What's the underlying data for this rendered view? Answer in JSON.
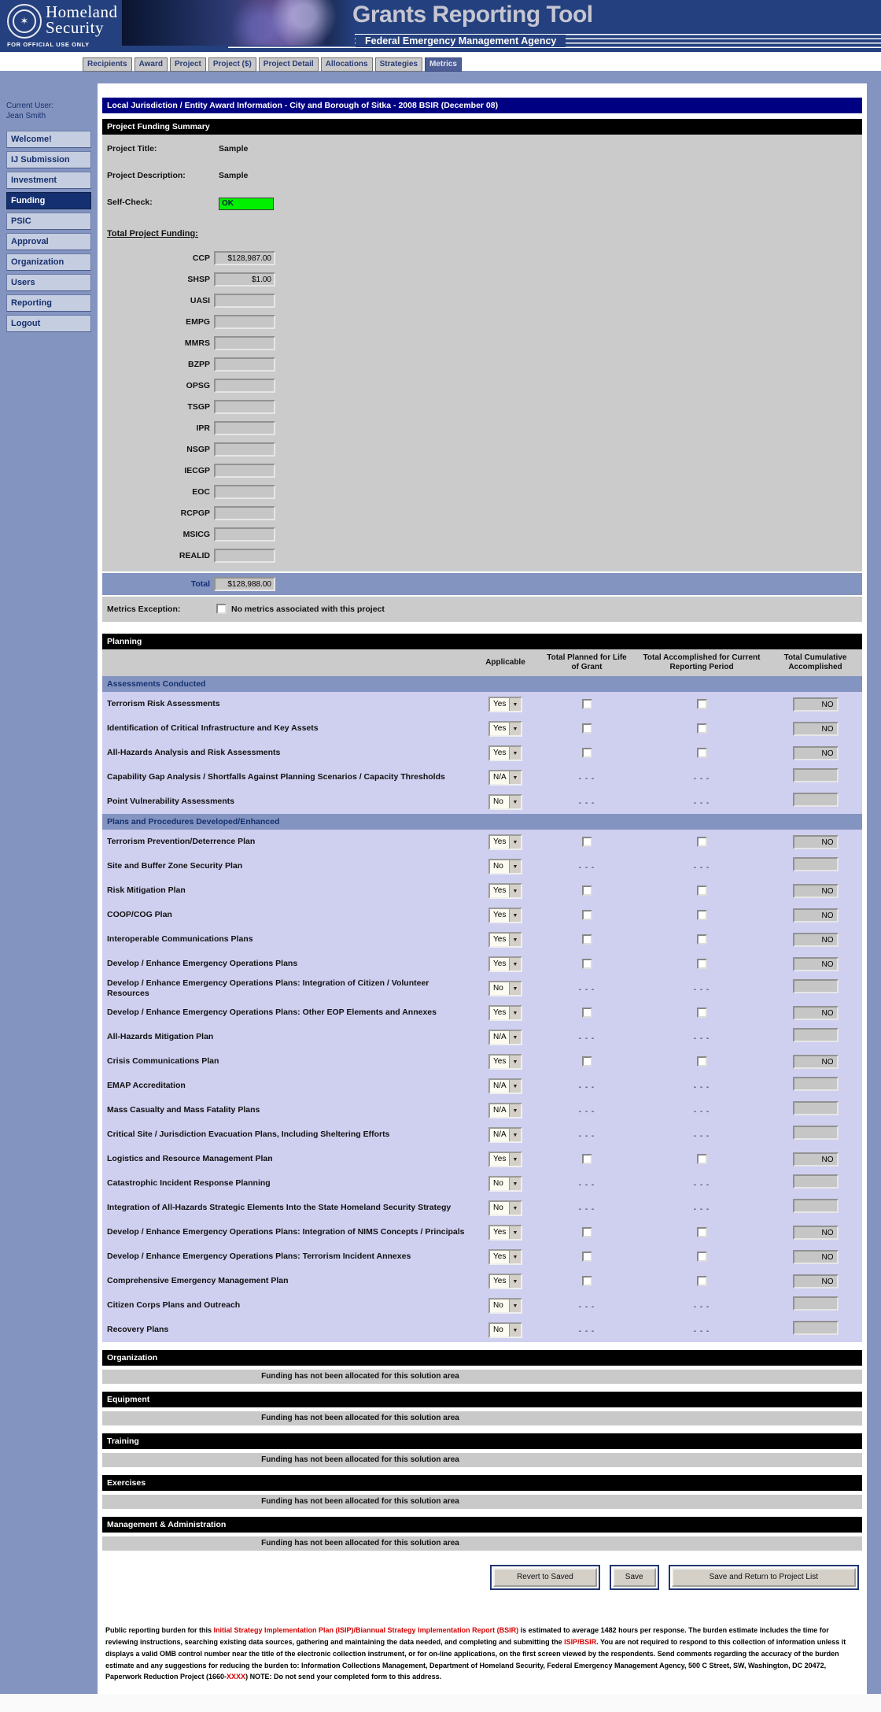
{
  "header": {
    "brand_line1": "Homeland",
    "brand_line2": "Security",
    "fouo": "FOR OFFICIAL USE ONLY",
    "app_title": "Grants Reporting Tool",
    "agency": "Federal Emergency Management Agency",
    "header_color": "#24407e"
  },
  "tabs": [
    {
      "label": "Recipients",
      "active": false
    },
    {
      "label": "Award",
      "active": false
    },
    {
      "label": "Project",
      "active": false
    },
    {
      "label": "Project ($)",
      "active": false
    },
    {
      "label": "Project Detail",
      "active": false
    },
    {
      "label": "Allocations",
      "active": false
    },
    {
      "label": "Strategies",
      "active": false
    },
    {
      "label": "Metrics",
      "active": true
    }
  ],
  "sidebar": {
    "current_user_label": "Current User:",
    "current_user_name": "Jean Smith",
    "items": [
      {
        "label": "Welcome!",
        "active": false
      },
      {
        "label": "IJ Submission",
        "active": false
      },
      {
        "label": "Investment",
        "active": false
      },
      {
        "label": "Funding",
        "active": true
      },
      {
        "label": "PSIC",
        "active": false
      },
      {
        "label": "Approval",
        "active": false
      },
      {
        "label": "Organization",
        "active": false
      },
      {
        "label": "Users",
        "active": false
      },
      {
        "label": "Reporting",
        "active": false
      },
      {
        "label": "Logout",
        "active": false
      }
    ]
  },
  "page": {
    "title_bar": "Local Jurisdiction / Entity Award Information - City and Borough of Sitka - 2008 BSIR (December 08)",
    "funding_summary": {
      "section_label": "Project Funding Summary",
      "project_title_label": "Project Title:",
      "project_title_value": "Sample",
      "project_description_label": "Project Description:",
      "project_description_value": "Sample",
      "self_check_label": "Self-Check:",
      "self_check_value": "OK",
      "self_check_color": "#00f000",
      "total_project_funding_label": "Total Project Funding:",
      "fields": [
        {
          "code": "CCP",
          "value": "$128,987.00"
        },
        {
          "code": "SHSP",
          "value": "$1.00"
        },
        {
          "code": "UASI",
          "value": ""
        },
        {
          "code": "EMPG",
          "value": ""
        },
        {
          "code": "MMRS",
          "value": ""
        },
        {
          "code": "BZPP",
          "value": ""
        },
        {
          "code": "OPSG",
          "value": ""
        },
        {
          "code": "TSGP",
          "value": ""
        },
        {
          "code": "IPR",
          "value": ""
        },
        {
          "code": "NSGP",
          "value": ""
        },
        {
          "code": "IECGP",
          "value": ""
        },
        {
          "code": "EOC",
          "value": ""
        },
        {
          "code": "RCPGP",
          "value": ""
        },
        {
          "code": "MSICG",
          "value": ""
        },
        {
          "code": "REALID",
          "value": ""
        }
      ],
      "total_label": "Total",
      "total_value": "$128,988.00",
      "metrics_exception_label": "Metrics Exception:",
      "metrics_exception_checkbox_label": "No metrics associated with this project",
      "metrics_exception_checked": false
    },
    "planning": {
      "section_label": "Planning",
      "columns": [
        "Applicable",
        "Total Planned for Life of Grant",
        "Total Accomplished for Current Reporting Period",
        "Total Cumulative Accomplished"
      ],
      "na_placeholder": "- - -",
      "groups": [
        {
          "label": "Assessments Conducted",
          "rows": [
            {
              "label": "Terrorism Risk Assessments",
              "applicable": "Yes",
              "cumulative": "NO"
            },
            {
              "label": "Identification of Critical Infrastructure and Key Assets",
              "applicable": "Yes",
              "cumulative": "NO"
            },
            {
              "label": "All-Hazards Analysis and Risk Assessments",
              "applicable": "Yes",
              "cumulative": "NO"
            },
            {
              "label": "Capability Gap Analysis / Shortfalls Against Planning Scenarios / Capacity Thresholds",
              "applicable": "N/A",
              "cumulative": ""
            },
            {
              "label": "Point Vulnerability Assessments",
              "applicable": "No",
              "cumulative": ""
            }
          ]
        },
        {
          "label": "Plans and Procedures Developed/Enhanced",
          "rows": [
            {
              "label": "Terrorism Prevention/Deterrence Plan",
              "applicable": "Yes",
              "cumulative": "NO"
            },
            {
              "label": "Site and Buffer Zone Security Plan",
              "applicable": "No",
              "cumulative": ""
            },
            {
              "label": "Risk Mitigation Plan",
              "applicable": "Yes",
              "cumulative": "NO"
            },
            {
              "label": "COOP/COG Plan",
              "applicable": "Yes",
              "cumulative": "NO"
            },
            {
              "label": "Interoperable Communications Plans",
              "applicable": "Yes",
              "cumulative": "NO"
            },
            {
              "label": "Develop / Enhance Emergency Operations Plans",
              "applicable": "Yes",
              "cumulative": "NO"
            },
            {
              "label": "Develop / Enhance Emergency Operations Plans: Integration of Citizen / Volunteer Resources",
              "applicable": "No",
              "cumulative": ""
            },
            {
              "label": "Develop / Enhance Emergency Operations Plans: Other EOP Elements and Annexes",
              "applicable": "Yes",
              "cumulative": "NO"
            },
            {
              "label": "All-Hazards Mitigation Plan",
              "applicable": "N/A",
              "cumulative": ""
            },
            {
              "label": "Crisis Communications Plan",
              "applicable": "Yes",
              "cumulative": "NO"
            },
            {
              "label": "EMAP Accreditation",
              "applicable": "N/A",
              "cumulative": ""
            },
            {
              "label": "Mass Casualty and Mass Fatality Plans",
              "applicable": "N/A",
              "cumulative": ""
            },
            {
              "label": "Critical Site / Jurisdiction Evacuation Plans, Including Sheltering Efforts",
              "applicable": "N/A",
              "cumulative": ""
            },
            {
              "label": "Logistics and Resource Management Plan",
              "applicable": "Yes",
              "cumulative": "NO"
            },
            {
              "label": "Catastrophic Incident Response Planning",
              "applicable": "No",
              "cumulative": ""
            },
            {
              "label": "Integration of All-Hazards Strategic Elements Into the State Homeland Security Strategy",
              "applicable": "No",
              "cumulative": ""
            },
            {
              "label": "Develop / Enhance Emergency Operations Plans: Integration of NIMS Concepts / Principals",
              "applicable": "Yes",
              "cumulative": "NO"
            },
            {
              "label": "Develop / Enhance Emergency Operations Plans: Terrorism Incident Annexes",
              "applicable": "Yes",
              "cumulative": "NO"
            },
            {
              "label": "Comprehensive Emergency Management Plan",
              "applicable": "Yes",
              "cumulative": "NO"
            },
            {
              "label": "Citizen Corps Plans and Outreach",
              "applicable": "No",
              "cumulative": ""
            },
            {
              "label": "Recovery Plans",
              "applicable": "No",
              "cumulative": ""
            }
          ]
        }
      ]
    },
    "solution_areas": [
      {
        "label": "Organization",
        "message": "Funding has not been allocated for this solution area"
      },
      {
        "label": "Equipment",
        "message": "Funding has not been allocated for this solution area"
      },
      {
        "label": "Training",
        "message": "Funding has not been allocated for this solution area"
      },
      {
        "label": "Exercises",
        "message": "Funding has not been allocated for this solution area"
      },
      {
        "label": "Management & Administration",
        "message": "Funding has not been allocated for this solution area"
      }
    ],
    "buttons": [
      "Revert to Saved",
      "Save",
      "Save and Return to Project List"
    ],
    "footer_segments": [
      {
        "text": "Public reporting burden for this ",
        "style": "normal"
      },
      {
        "text": "Initial Strategy Implementation Plan (ISIP)/Biannual Strategy Implementation Report (BSIR)",
        "style": "red"
      },
      {
        "text": " is estimated to average 1482 hours per response. The burden estimate includes the time for reviewing instructions, searching existing data sources, gathering and maintaining the data needed, and completing and submitting the ",
        "style": "normal"
      },
      {
        "text": "ISIP/BSIR",
        "style": "red"
      },
      {
        "text": ". You are not required to respond to this collection of information unless it displays a valid OMB control number near the title of the electronic collection instrument, or for on-line applications, on the first screen viewed by the respondents. Send comments regarding the accuracy of the burden estimate and any suggestions for reducing the burden to: Information Collections Management, Department of Homeland Security, Federal Emergency Management Agency, 500 C Street, SW, Washington, DC 20472, Paperwork Reduction Project (1660-",
        "style": "normal"
      },
      {
        "text": "XXXX",
        "style": "red"
      },
      {
        "text": ") ",
        "style": "normal"
      },
      {
        "text": "NOTE: Do not send your completed form to this address.",
        "style": "bold"
      }
    ]
  }
}
